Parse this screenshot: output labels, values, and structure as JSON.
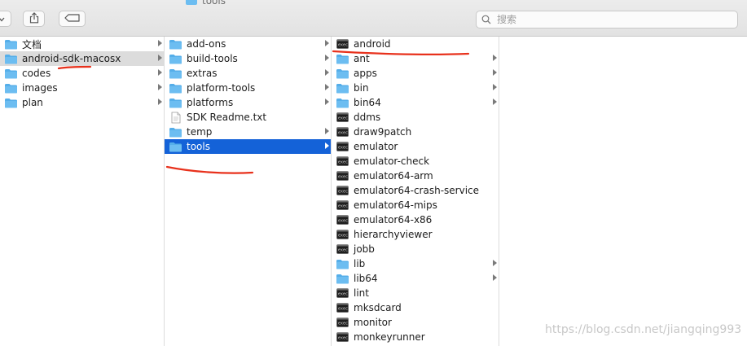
{
  "window": {
    "title": "tools"
  },
  "toolbar": {
    "search_placeholder": "搜索",
    "icons": {
      "nav": "chevron-down-icon",
      "share": "share-icon",
      "tag": "tag-icon",
      "search": "search-icon"
    }
  },
  "columns": [
    {
      "items": [
        {
          "label": "文档",
          "kind": "folder",
          "chevron": true
        },
        {
          "label": "android-sdk-macosx",
          "kind": "folder",
          "chevron": true,
          "state": "selected"
        },
        {
          "label": "codes",
          "kind": "folder",
          "chevron": true
        },
        {
          "label": "images",
          "kind": "folder",
          "chevron": true
        },
        {
          "label": "plan",
          "kind": "folder",
          "chevron": true
        }
      ]
    },
    {
      "items": [
        {
          "label": "add-ons",
          "kind": "folder",
          "chevron": true
        },
        {
          "label": "build-tools",
          "kind": "folder",
          "chevron": true
        },
        {
          "label": "extras",
          "kind": "folder",
          "chevron": true
        },
        {
          "label": "platform-tools",
          "kind": "folder",
          "chevron": true
        },
        {
          "label": "platforms",
          "kind": "folder",
          "chevron": true
        },
        {
          "label": "SDK Readme.txt",
          "kind": "document",
          "chevron": false
        },
        {
          "label": "temp",
          "kind": "folder",
          "chevron": true
        },
        {
          "label": "tools",
          "kind": "folder",
          "chevron": true,
          "state": "active"
        }
      ]
    },
    {
      "items": [
        {
          "label": "android",
          "kind": "executable",
          "chevron": false
        },
        {
          "label": "ant",
          "kind": "folder",
          "chevron": true
        },
        {
          "label": "apps",
          "kind": "folder",
          "chevron": true
        },
        {
          "label": "bin",
          "kind": "folder",
          "chevron": true
        },
        {
          "label": "bin64",
          "kind": "folder",
          "chevron": true
        },
        {
          "label": "ddms",
          "kind": "executable",
          "chevron": false
        },
        {
          "label": "draw9patch",
          "kind": "executable",
          "chevron": false
        },
        {
          "label": "emulator",
          "kind": "executable",
          "chevron": false
        },
        {
          "label": "emulator-check",
          "kind": "executable",
          "chevron": false
        },
        {
          "label": "emulator64-arm",
          "kind": "executable",
          "chevron": false
        },
        {
          "label": "emulator64-crash-service",
          "kind": "executable",
          "chevron": false
        },
        {
          "label": "emulator64-mips",
          "kind": "executable",
          "chevron": false
        },
        {
          "label": "emulator64-x86",
          "kind": "executable",
          "chevron": false
        },
        {
          "label": "hierarchyviewer",
          "kind": "executable",
          "chevron": false
        },
        {
          "label": "jobb",
          "kind": "executable",
          "chevron": false
        },
        {
          "label": "lib",
          "kind": "folder",
          "chevron": true
        },
        {
          "label": "lib64",
          "kind": "folder",
          "chevron": true
        },
        {
          "label": "lint",
          "kind": "executable",
          "chevron": false
        },
        {
          "label": "mksdcard",
          "kind": "executable",
          "chevron": false
        },
        {
          "label": "monitor",
          "kind": "executable",
          "chevron": false
        },
        {
          "label": "monkeyrunner",
          "kind": "executable",
          "chevron": false
        }
      ]
    },
    {
      "items": []
    }
  ],
  "colors": {
    "folder": "#6cbdf1",
    "folder_tab": "#55aee9",
    "selection_active": "#1462d8",
    "selection_inactive": "#dcdcdc",
    "annotation": "#e8311c",
    "executable": "#1e1e1e"
  },
  "watermark": "https://blog.csdn.net/jiangqing993"
}
